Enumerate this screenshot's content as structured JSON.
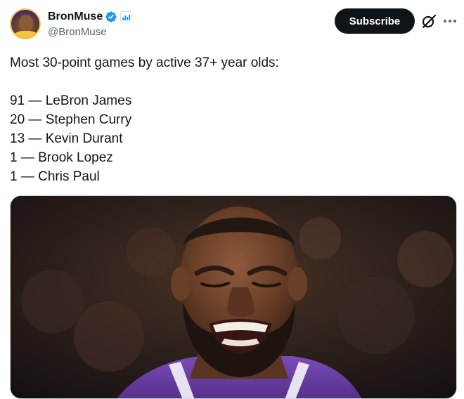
{
  "author": {
    "display_name": "BronMuse",
    "handle": "@BronMuse",
    "verified": true,
    "verified_color": "#1d9bf0"
  },
  "actions": {
    "subscribe_label": "Subscribe",
    "grok_icon": "grok-icon",
    "more_icon": "more-icon"
  },
  "tweet": {
    "intro": "Most 30-point games by active 37+ year olds:",
    "list": [
      "91 — LeBron James",
      "20 — Stephen Curry",
      "13 — Kevin Durant",
      "1 — Brook Lopez",
      "1 — Chris Paul"
    ]
  },
  "colors": {
    "text": "#0f1419",
    "secondary": "#536471",
    "accent": "#1d9bf0",
    "button_bg": "#0f1419",
    "jersey_purple": "#5b2d86"
  }
}
